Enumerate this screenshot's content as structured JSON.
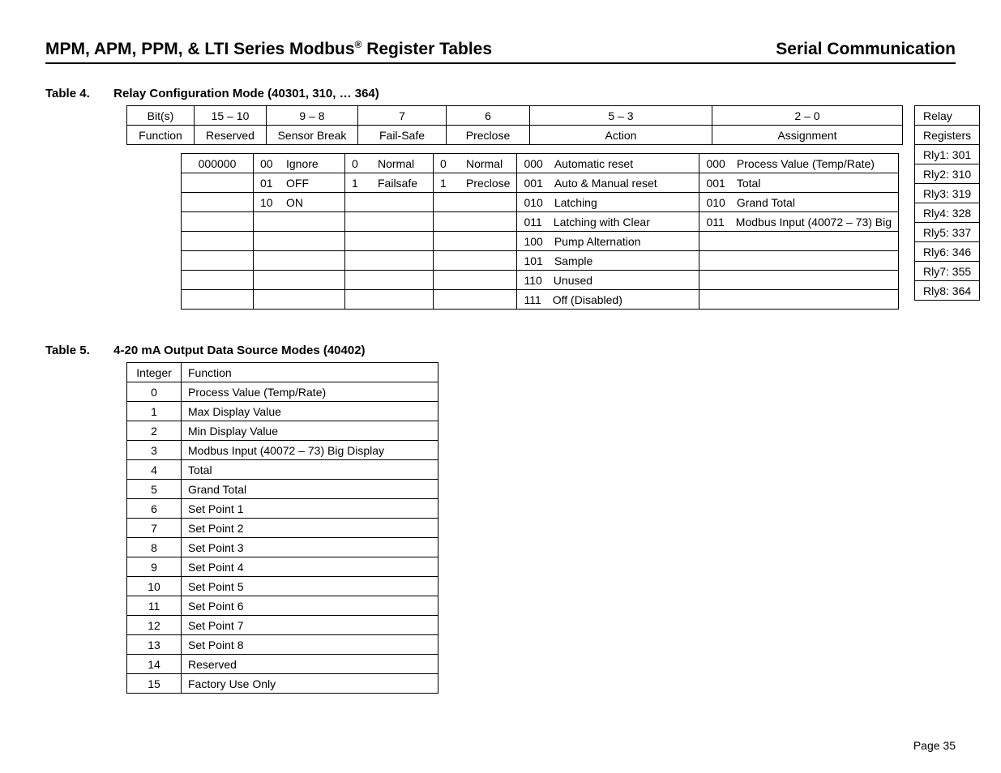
{
  "header": {
    "title_prefix": "MPM, APM, PPM, & LTI Series Modbus",
    "title_suffix": " Register Tables",
    "right": "Serial Communication"
  },
  "table4": {
    "caption_num": "Table 4.",
    "caption_text": "Relay Configuration Mode (40301, 310, … 364)",
    "row1": [
      "Bit(s)",
      "15 – 10",
      "9 – 8",
      "7",
      "6",
      "5 – 3",
      "2 – 0"
    ],
    "row2": [
      "Function",
      "Reserved",
      "Sensor Break",
      "Fail-Safe",
      "Preclose",
      "Action",
      "Assignment"
    ],
    "body": [
      {
        "c1510": "000000",
        "c98": {
          "code": "00",
          "txt": "Ignore"
        },
        "c7": {
          "code": "0",
          "txt": "Normal"
        },
        "c6": {
          "code": "0",
          "txt": "Normal"
        },
        "c53": {
          "code": "000",
          "txt": "Automatic reset"
        },
        "c20": {
          "code": "000",
          "txt": "Process Value (Temp/Rate)"
        }
      },
      {
        "c1510": "",
        "c98": {
          "code": "01",
          "txt": "OFF"
        },
        "c7": {
          "code": "1",
          "txt": "Failsafe"
        },
        "c6": {
          "code": "1",
          "txt": "Preclose"
        },
        "c53": {
          "code": "001",
          "txt": "Auto & Manual reset"
        },
        "c20": {
          "code": "001",
          "txt": "Total"
        }
      },
      {
        "c1510": "",
        "c98": {
          "code": "10",
          "txt": "ON"
        },
        "c7": {
          "code": "",
          "txt": ""
        },
        "c6": {
          "code": "",
          "txt": ""
        },
        "c53": {
          "code": "010",
          "txt": "Latching"
        },
        "c20": {
          "code": "010",
          "txt": "Grand Total"
        }
      },
      {
        "c1510": "",
        "c98": {
          "code": "",
          "txt": ""
        },
        "c7": {
          "code": "",
          "txt": ""
        },
        "c6": {
          "code": "",
          "txt": ""
        },
        "c53": {
          "code": "011",
          "txt": "Latching with Clear"
        },
        "c20": {
          "code": "011",
          "txt": "Modbus Input (40072 – 73) Big"
        }
      },
      {
        "c1510": "",
        "c98": {
          "code": "",
          "txt": ""
        },
        "c7": {
          "code": "",
          "txt": ""
        },
        "c6": {
          "code": "",
          "txt": ""
        },
        "c53": {
          "code": "100",
          "txt": "Pump Alternation"
        },
        "c20": {
          "code": "",
          "txt": ""
        }
      },
      {
        "c1510": "",
        "c98": {
          "code": "",
          "txt": ""
        },
        "c7": {
          "code": "",
          "txt": ""
        },
        "c6": {
          "code": "",
          "txt": ""
        },
        "c53": {
          "code": "101",
          "txt": "Sample"
        },
        "c20": {
          "code": "",
          "txt": ""
        }
      },
      {
        "c1510": "",
        "c98": {
          "code": "",
          "txt": ""
        },
        "c7": {
          "code": "",
          "txt": ""
        },
        "c6": {
          "code": "",
          "txt": ""
        },
        "c53": {
          "code": "110",
          "txt": "Unused"
        },
        "c20": {
          "code": "",
          "txt": ""
        }
      },
      {
        "c1510": "",
        "c98": {
          "code": "",
          "txt": ""
        },
        "c7": {
          "code": "",
          "txt": ""
        },
        "c6": {
          "code": "",
          "txt": ""
        },
        "c53": {
          "code": "111",
          "txt": "Off (Disabled)"
        },
        "c20": {
          "code": "",
          "txt": ""
        }
      }
    ],
    "relay_header1": "Relay",
    "relay_header2": "Registers",
    "relays": [
      "Rly1: 301",
      "Rly2: 310",
      "Rly3: 319",
      "Rly4: 328",
      "Rly5: 337",
      "Rly6: 346",
      "Rly7: 355",
      "Rly8: 364"
    ]
  },
  "table5": {
    "caption_num": "Table 5.",
    "caption_text": "4-20 mA Output Data Source Modes (40402)",
    "head": [
      "Integer",
      "Function"
    ],
    "rows": [
      {
        "i": "0",
        "f": "Process Value (Temp/Rate)"
      },
      {
        "i": "1",
        "f": "Max Display Value"
      },
      {
        "i": "2",
        "f": "Min Display Value"
      },
      {
        "i": "3",
        "f": "Modbus Input (40072 – 73) Big Display"
      },
      {
        "i": "4",
        "f": "Total"
      },
      {
        "i": "5",
        "f": "Grand Total"
      },
      {
        "i": "6",
        "f": "Set Point 1"
      },
      {
        "i": "7",
        "f": "Set Point 2"
      },
      {
        "i": "8",
        "f": "Set Point 3"
      },
      {
        "i": "9",
        "f": "Set Point 4"
      },
      {
        "i": "10",
        "f": "Set Point 5"
      },
      {
        "i": "11",
        "f": "Set Point 6"
      },
      {
        "i": "12",
        "f": "Set Point 7"
      },
      {
        "i": "13",
        "f": "Set Point 8"
      },
      {
        "i": "14",
        "f": "Reserved"
      },
      {
        "i": "15",
        "f": "Factory Use Only"
      }
    ]
  },
  "footer": {
    "page": "Page 35"
  }
}
